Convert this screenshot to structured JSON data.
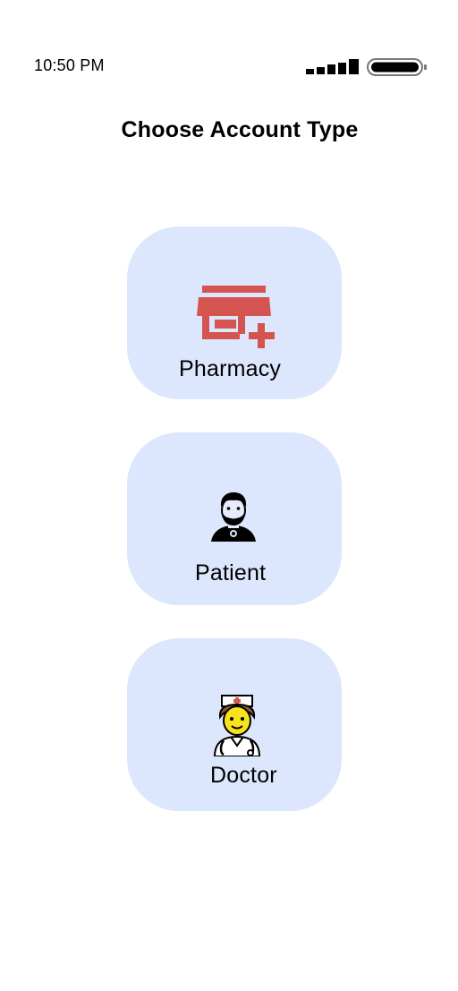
{
  "status_bar": {
    "time": "10:50 PM",
    "signal_icon": "cellular-signal-icon",
    "battery_icon": "battery-icon"
  },
  "title": "Choose Account Type",
  "options": [
    {
      "label": "Pharmacy",
      "icon": "pharmacy-store-icon",
      "icon_color": "#d4554f"
    },
    {
      "label": "Patient",
      "icon": "patient-avatar-icon"
    },
    {
      "label": "Doctor",
      "icon": "doctor-avatar-icon"
    }
  ],
  "colors": {
    "card_background": "#dce6fd",
    "background": "#ffffff",
    "text": "#000000"
  }
}
